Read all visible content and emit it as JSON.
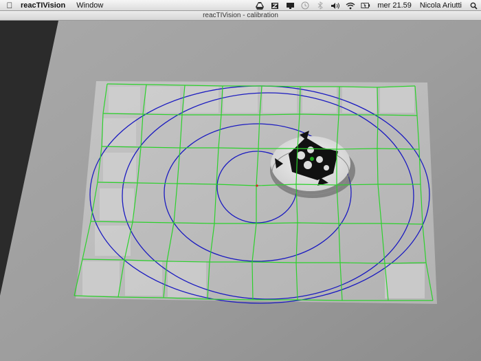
{
  "menubar": {
    "apple_icon": "apple-logo-icon",
    "app_name": "reacTIVision",
    "menu_items": [
      "Window"
    ],
    "clock": "mer 21.59",
    "user": "Nicola Ariutti"
  },
  "window": {
    "title": "reacTIVision - calibration"
  }
}
